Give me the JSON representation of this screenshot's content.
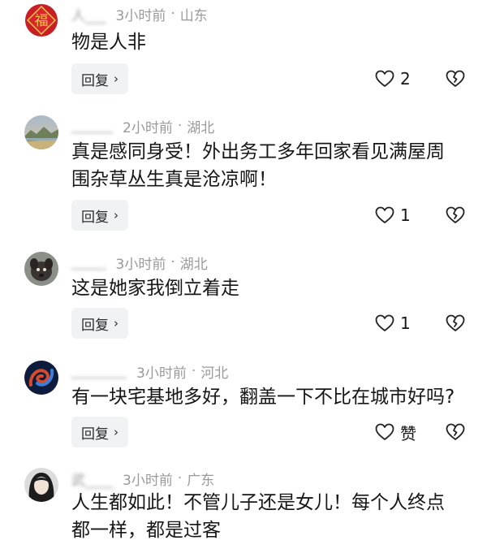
{
  "ui": {
    "reply_label": "回复",
    "reply_chevron": "›"
  },
  "comments": [
    {
      "name": "人___",
      "time": "3小时前",
      "separator": "·",
      "location": "山东",
      "lines": [
        "物是人非"
      ],
      "likes": "2",
      "avatar": {
        "kind": "fu-emblem",
        "char": "福",
        "bg": "#c81f26",
        "fg": "#f2c64b"
      }
    },
    {
      "name": "______",
      "time": "2小时前",
      "separator": "·",
      "location": "湖北",
      "lines": [
        "真是感同身受！外出务工多年回家看见满屋周",
        "围杂草丛生真是沧凉啊！"
      ],
      "likes": "1",
      "avatar": {
        "kind": "landscape"
      }
    },
    {
      "name": "_____",
      "time": "3小时前",
      "separator": "·",
      "location": "湖北",
      "lines": [
        "这是她家我倒立着走"
      ],
      "likes": "1",
      "avatar": {
        "kind": "puppy"
      }
    },
    {
      "name": "________",
      "time": "3小时前",
      "separator": "·",
      "location": "河北",
      "lines": [
        "有一块宅基地多好，翻盖一下不比在城市好吗?"
      ],
      "likes": "赞",
      "avatar": {
        "kind": "swirl"
      }
    },
    {
      "name": "武____",
      "time": "3小时前",
      "separator": "·",
      "location": "广东",
      "lines": [
        "人生都如此！不管儿子还是女儿！每个人终点",
        "都一样，都是过客"
      ],
      "likes": null,
      "avatar": {
        "kind": "portrait"
      }
    }
  ]
}
